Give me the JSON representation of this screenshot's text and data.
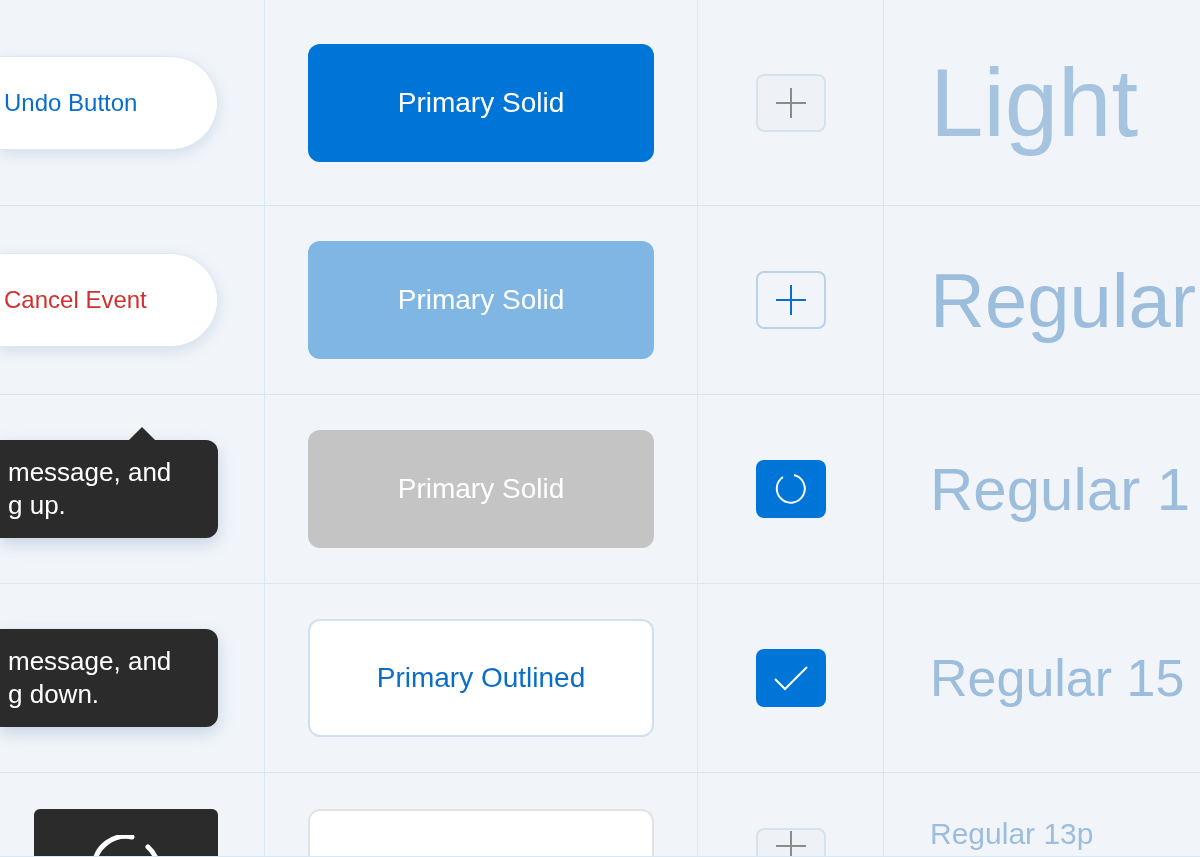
{
  "rows": [
    {
      "left": {
        "kind": "pill",
        "destructive": false,
        "label": "Undo Button"
      },
      "button": {
        "kind": "solid",
        "highlighted": false,
        "disabled": false,
        "label": "Primary Solid"
      },
      "icon": {
        "kind": "add",
        "disabled": true
      },
      "sample": {
        "kind": "light",
        "text": "Light"
      }
    },
    {
      "left": {
        "kind": "pill",
        "destructive": true,
        "label": "Cancel Event"
      },
      "button": {
        "kind": "solid",
        "highlighted": true,
        "disabled": false,
        "label": "Primary Solid"
      },
      "icon": {
        "kind": "add",
        "disabled": false
      },
      "sample": {
        "kind": "regular",
        "text": "Regular"
      }
    },
    {
      "left": {
        "kind": "tooltip",
        "arrow": true,
        "text": "message, and g up."
      },
      "button": {
        "kind": "solid",
        "highlighted": false,
        "disabled": true,
        "label": "Primary Solid"
      },
      "icon": {
        "kind": "loading"
      },
      "sample": {
        "kind": "regular",
        "text": "Regular 1"
      }
    },
    {
      "left": {
        "kind": "tooltip",
        "arrow": false,
        "text": "message, and g down."
      },
      "button": {
        "kind": "outlined",
        "label": "Primary Outlined"
      },
      "icon": {
        "kind": "checked"
      },
      "sample": {
        "kind": "regular",
        "text": "Regular 15"
      }
    },
    {
      "left": {
        "kind": "spinner_tile"
      },
      "button": {
        "kind": "blank"
      },
      "icon": {
        "kind": "add",
        "disabled": true
      },
      "sample": {
        "kind": "regular",
        "text": "Regular 13p"
      }
    }
  ]
}
